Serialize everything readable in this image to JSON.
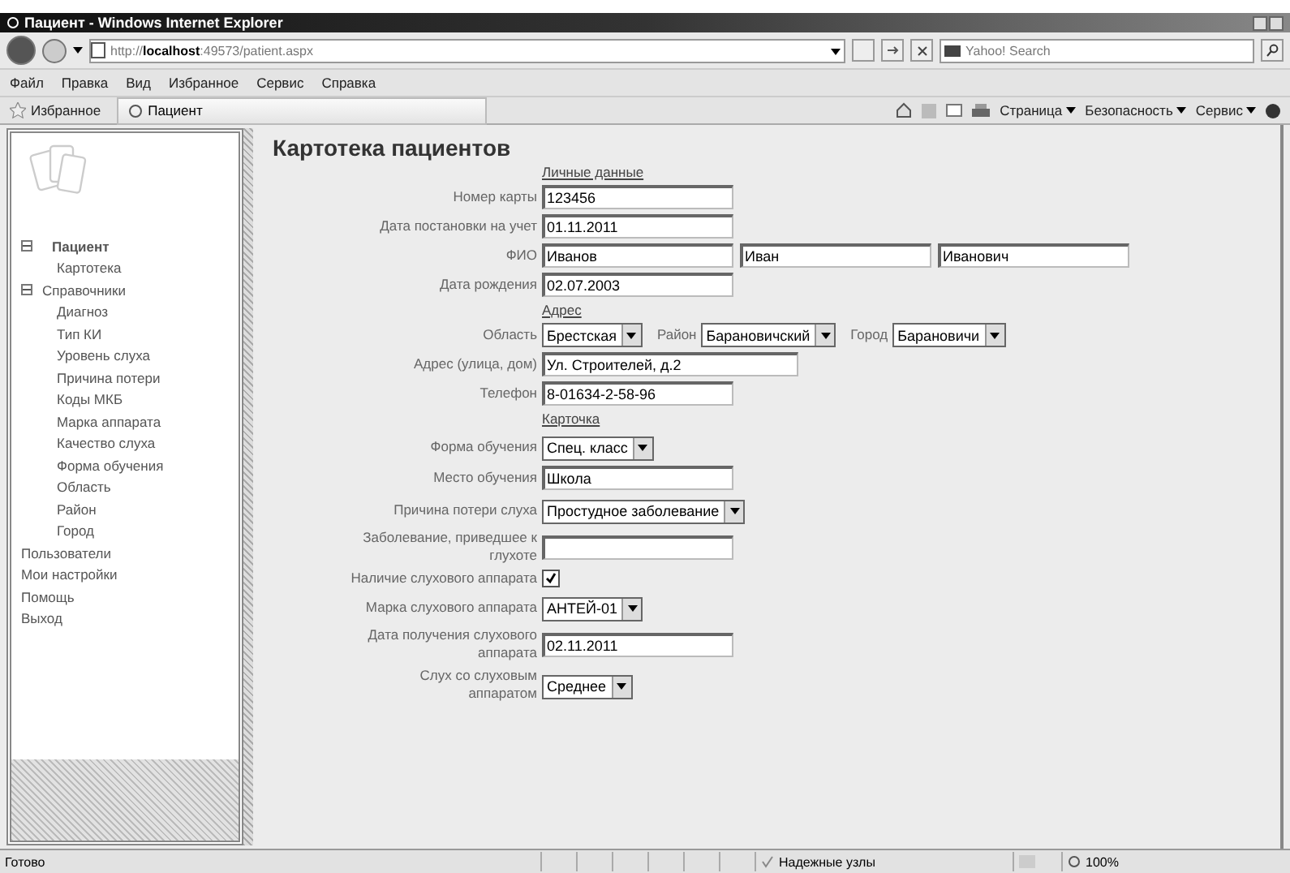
{
  "window": {
    "title": "Пациент - Windows Internet Explorer"
  },
  "address_bar": {
    "url_prefix": "http://",
    "url_host": "localhost",
    "url_rest": ":49573/patient.aspx",
    "search_placeholder": "Yahoo! Search"
  },
  "menu": [
    "Файл",
    "Правка",
    "Вид",
    "Избранное",
    "Сервис",
    "Справка"
  ],
  "favorites": {
    "label": "Избранное",
    "tab": "Пациент",
    "tools": [
      "Страница",
      "Безопасность",
      "Сервис"
    ]
  },
  "sidebar": {
    "items": [
      {
        "label": "Пациент",
        "bold": true,
        "expanded": true,
        "children": [
          {
            "label": "Картотека"
          }
        ]
      },
      {
        "label": "Справочники",
        "bold": false,
        "expanded": true,
        "children": [
          {
            "label": "Диагноз"
          },
          {
            "label": "Тип КИ"
          },
          {
            "label": "Уровень слуха"
          },
          {
            "label": "Причина потери"
          },
          {
            "label": "Коды МКБ"
          },
          {
            "label": "Марка аппарата"
          },
          {
            "label": "Качество слуха"
          },
          {
            "label": "Форма обучения"
          },
          {
            "label": "Область"
          },
          {
            "label": "Район"
          },
          {
            "label": "Город"
          }
        ]
      },
      {
        "label": "Пользователи"
      },
      {
        "label": "Мои настройки"
      },
      {
        "label": "Помощь"
      },
      {
        "label": "Выход"
      }
    ]
  },
  "page_title": "Картотека пациентов",
  "form": [
    {
      "kind": "section",
      "label": "Личные данные"
    },
    {
      "kind": "text",
      "label": "Номер карты",
      "value": "123456"
    },
    {
      "kind": "text",
      "label": "Дата постановки на учет",
      "value": "01.11.2011"
    },
    {
      "kind": "inputs",
      "label": "ФИО",
      "values": [
        "Иванов",
        "Иван",
        "Иванович"
      ]
    },
    {
      "kind": "text",
      "label": "Дата рождения",
      "value": "02.07.2003"
    },
    {
      "kind": "section",
      "label": "Адрес"
    },
    {
      "kind": "selects",
      "items": [
        {
          "label": "Область",
          "value": "Брестская"
        },
        {
          "label": "Район",
          "value": "Барановичский"
        },
        {
          "label": "Город",
          "value": "Барановичи"
        }
      ]
    },
    {
      "kind": "text",
      "label": "Адрес (улица, дом)",
      "value": "Ул. Строителей, д.2",
      "wide": true
    },
    {
      "kind": "text",
      "label": "Телефон",
      "value": "8-01634-2-58-96"
    },
    {
      "kind": "section",
      "label": "Карточка"
    },
    {
      "kind": "select",
      "label": "Форма обучения",
      "value": "Спец. класс"
    },
    {
      "kind": "text",
      "label": "Место обучения",
      "value": "Школа"
    },
    {
      "kind": "select",
      "label": "Причина потери слуха",
      "value": "Простудное заболевание"
    },
    {
      "kind": "text",
      "label": "Заболевание, приведшее к глухоте"
    },
    {
      "kind": "checkbox",
      "label": "Наличие слухового аппарата",
      "checked": true
    },
    {
      "kind": "select",
      "label": "Марка слухового аппарата",
      "value": "АНТЕЙ-01"
    },
    {
      "kind": "text",
      "label": "Дата получения слухового аппарата",
      "value": "02.11.2011"
    },
    {
      "kind": "select",
      "label": "Слух со слуховым аппаратом",
      "value": "Среднее"
    }
  ],
  "status_bar": {
    "text": "Готово",
    "zone": "Надежные узлы",
    "zoom": "100%"
  }
}
